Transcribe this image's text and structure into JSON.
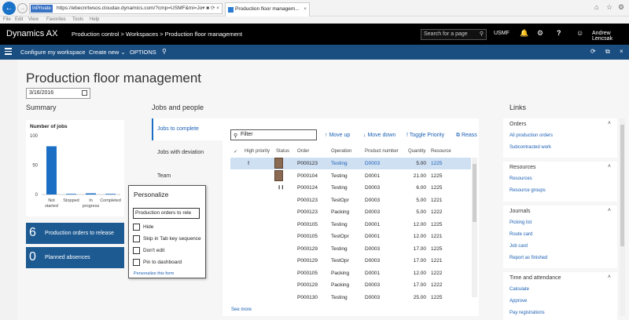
{
  "browser": {
    "inprivate": "InPrivate",
    "url": "https://ebecnrtwsos.cloudax.dynamics.com/?cmp=USMF&mi=Jo",
    "tab_title": "Production floor managem...",
    "menu": [
      "File",
      "Edit",
      "View",
      "Favorites",
      "Tools",
      "Help"
    ]
  },
  "nav": {
    "brand": "Dynamics AX",
    "breadcrumb": "Production control  >  Workspaces  >  Production floor management",
    "search_placeholder": "Search for a page",
    "company": "USMF",
    "user": "Andrew Lencsak"
  },
  "actions": {
    "configure": "Configure my workspace",
    "create_new": "Create new ⌄",
    "options": "OPTIONS"
  },
  "page": {
    "title": "Production floor management",
    "date": "3/16/2016"
  },
  "summary": {
    "heading": "Summary",
    "tiles": [
      {
        "count": "6",
        "label": "Production orders to release"
      },
      {
        "count": "0",
        "label": "Planned absences"
      }
    ]
  },
  "chart_data": {
    "type": "bar",
    "title": "Number of jobs",
    "categories": [
      "Not started",
      "Stopped",
      "In progress",
      "Completed"
    ],
    "values": [
      82,
      0,
      2,
      0
    ],
    "ylim": [
      0,
      100
    ],
    "yticks": [
      "100",
      "50",
      "0"
    ],
    "category_labels": [
      "Not\nstarted",
      "Stopped",
      "In\nprogress",
      "Completed"
    ],
    "colors": {
      "bar": "#1a6fc4"
    }
  },
  "jobs": {
    "heading": "Jobs and people",
    "tabs": [
      "Jobs to complete",
      "Jobs with deviation",
      "Team"
    ],
    "filter_placeholder": "Filter",
    "toolbar": {
      "move_up": "Move up",
      "move_down": "Move down",
      "toggle": "Toggle Priority",
      "reassign": "Reass"
    },
    "columns": [
      "High priority",
      "Status",
      "Order",
      "Operation",
      "Product number",
      "Quantity",
      "Resource"
    ],
    "rows": [
      {
        "priority": "!",
        "status": "avatar",
        "order": "P000123",
        "operation": "Testing",
        "product": "D0003",
        "qty": "5.00",
        "resource": "1225",
        "selected": true
      },
      {
        "priority": "",
        "status": "avatar",
        "order": "P000104",
        "operation": "Testing",
        "product": "D0001",
        "qty": "21.00",
        "resource": "1225"
      },
      {
        "priority": "",
        "status": "pause",
        "order": "P000124",
        "operation": "Testing",
        "product": "D0003",
        "qty": "6.00",
        "resource": "1225"
      },
      {
        "priority": "",
        "status": "",
        "order": "P000123",
        "operation": "TestOpr",
        "product": "D0003",
        "qty": "5.00",
        "resource": "1221"
      },
      {
        "priority": "",
        "status": "",
        "order": "P000123",
        "operation": "Packing",
        "product": "D0003",
        "qty": "5.00",
        "resource": "1222"
      },
      {
        "priority": "",
        "status": "",
        "order": "P000105",
        "operation": "Testing",
        "product": "D0001",
        "qty": "12.00",
        "resource": "1225"
      },
      {
        "priority": "",
        "status": "",
        "order": "P000105",
        "operation": "TestOpr",
        "product": "D0001",
        "qty": "12.00",
        "resource": "1221"
      },
      {
        "priority": "",
        "status": "",
        "order": "P000129",
        "operation": "Testing",
        "product": "D0003",
        "qty": "17.00",
        "resource": "1225"
      },
      {
        "priority": "",
        "status": "",
        "order": "P000129",
        "operation": "TestOpr",
        "product": "D0003",
        "qty": "17.00",
        "resource": "1221"
      },
      {
        "priority": "",
        "status": "",
        "order": "P000105",
        "operation": "Packing",
        "product": "D0001",
        "qty": "12.00",
        "resource": "1222"
      },
      {
        "priority": "",
        "status": "",
        "order": "P000129",
        "operation": "Packing",
        "product": "D0003",
        "qty": "17.00",
        "resource": "1222"
      },
      {
        "priority": "",
        "status": "",
        "order": "P000130",
        "operation": "Testing",
        "product": "D0003",
        "qty": "25.00",
        "resource": "1225"
      }
    ],
    "see_more": "See more"
  },
  "personalize": {
    "title": "Personalize",
    "input_value": "Production orders to rele",
    "options": [
      "Hide",
      "Skip in Tab key sequence",
      "Don't edit",
      "Pin to dashboard"
    ],
    "link": "Personalize this form"
  },
  "links": {
    "heading": "Links",
    "groups": [
      {
        "title": "Orders",
        "items": [
          "All production orders",
          "Subcontracted work"
        ]
      },
      {
        "title": "Resources",
        "items": [
          "Resources",
          "Resource groups"
        ]
      },
      {
        "title": "Journals",
        "items": [
          "Picking list",
          "Route card",
          "Job card",
          "Report as finished"
        ]
      },
      {
        "title": "Time and attendance",
        "items": [
          "Calculate",
          "Approve",
          "Pay registrations"
        ]
      }
    ]
  }
}
